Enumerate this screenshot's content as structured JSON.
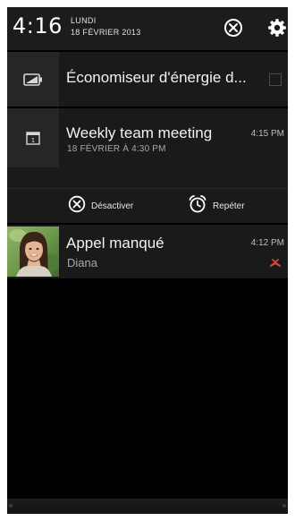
{
  "status": {
    "time": "4:16",
    "day": "LUNDI",
    "date": "18 FÉVRIER 2013",
    "clear_icon": "clear-all-icon",
    "settings_icon": "settings-gear-icon"
  },
  "notifications": [
    {
      "icon": "battery-saver-icon",
      "title": "Économiseur d'énergie d..."
    },
    {
      "icon": "calendar-icon",
      "title": "Weekly team meeting",
      "subtitle": "18 FÉVRIER À 4:30 PM",
      "time": "4:15 PM",
      "actions": {
        "dismiss": "Désactiver",
        "snooze": "Repéter"
      }
    },
    {
      "icon": "contact-photo",
      "title": "Appel manqué",
      "subtitle": "Diana",
      "time": "4:12 PM",
      "status_icon": "missed-call-icon"
    }
  ],
  "colors": {
    "background": "#000000",
    "panel": "#1a1a1a",
    "icon_box": "#262626",
    "missed_call": "#d94a3a"
  }
}
